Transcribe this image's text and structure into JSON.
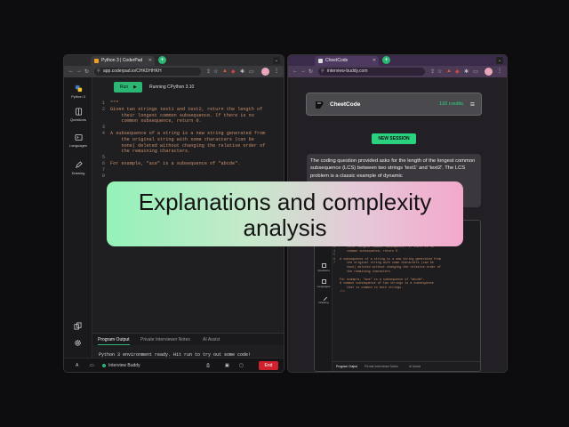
{
  "left_window": {
    "tab_title": "Python 3 | CoderPad",
    "url": "app.coderpad.io/CHKDHHKH",
    "rail": [
      {
        "label": "Python 3",
        "icon": "python-icon"
      },
      {
        "label": "Questions",
        "icon": "questions-icon"
      },
      {
        "label": "Languages",
        "icon": "languages-icon"
      },
      {
        "label": "Drawing",
        "icon": "pencil-icon"
      }
    ],
    "run_label": "Run",
    "runtime_label": "Running CPython 3.10",
    "line_numbers": [
      "1",
      "2",
      "",
      "",
      "3",
      "4",
      "",
      "",
      "",
      "5",
      "6",
      "7",
      "8"
    ],
    "code_lines": [
      "\"\"\"",
      "Given two strings text1 and text2, return the length of",
      "    their longest common subsequence. If there is no",
      "    common subsequence, return 0.",
      "",
      "A subsequence of a string is a new string generated from",
      "    the original string with some characters (can be",
      "    none) deleted without changing the relative order of",
      "    the remaining characters.",
      "",
      "For example, \"ace\" is a subsequence of \"abcde\".",
      "",
      ""
    ],
    "output_tabs": [
      "Program Output",
      "Private Interviewer Notes",
      "AI Assist"
    ],
    "console_text": "Python 3 environment ready. Hit run to try out some code!",
    "status_user": "Interview Buddy",
    "end_label": "End"
  },
  "right_window": {
    "tab_title": "CheetCode",
    "url": "interview-buddy.com",
    "brand": "CheetCode",
    "credits": "192 credits",
    "new_session_label": "NEW SESSION",
    "message": "The coding question provided asks for the length of the longest common subsequence (LCS) between two strings 'text1' and 'text2'. The LCS problem is a classic example of dynamic",
    "screenshot_rail": [
      "Questions",
      "Languages",
      "Drawing"
    ],
    "screenshot_line_numbers": [
      "",
      "",
      "3",
      "4",
      "",
      "",
      "",
      "5",
      "6",
      "",
      "",
      "7"
    ],
    "screenshot_code": [
      "    their longest common subsequence. If there is no",
      "    common subsequence, return 0.",
      "",
      "A subsequence of a string is a new string generated from",
      "    the original string with some characters (can be",
      "    none) deleted without changing the relative order of",
      "    the remaining characters.",
      "",
      "For example, \"ace\" is a subsequence of \"abcde\".",
      "A common subsequence of two strings is a subsequence",
      "    that is common to both strings.",
      "\"\"\""
    ],
    "screenshot_tabs": [
      "Program Output",
      "Private Interviewer Notes",
      "AI Assist"
    ]
  },
  "overlay": {
    "line1": "Explanations and complexity",
    "line2": "analysis"
  },
  "colors": {
    "accent_green": "#2bb673",
    "end_red": "#d0222e"
  }
}
